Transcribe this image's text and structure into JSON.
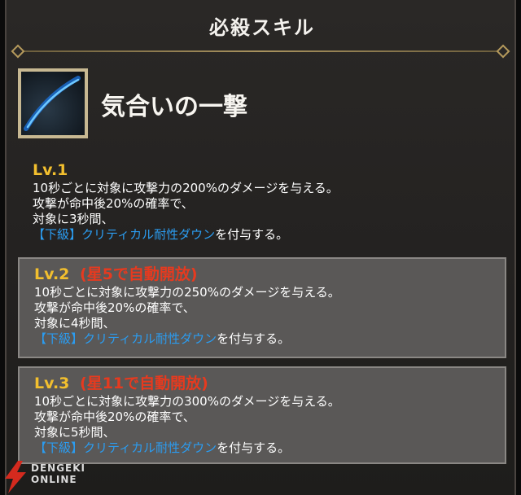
{
  "header": {
    "title": "必殺スキル"
  },
  "skill": {
    "icon": "slash-arc-icon",
    "name": "気合いの一撃"
  },
  "levels": [
    {
      "level": "Lv.1",
      "note": "",
      "lines": [
        "10秒ごとに対象に攻撃力の200%のダメージを与える。",
        "攻撃が命中後20%の確率で、",
        "対象に3秒間、"
      ],
      "debuff": "【下級】クリティカル耐性ダウン",
      "suffix": "を付与する。"
    },
    {
      "level": "Lv.2",
      "note": "(星5で自動開放)",
      "lines": [
        "10秒ごとに対象に攻撃力の250%のダメージを与える。",
        "攻撃が命中後20%の確率で、",
        "対象に4秒間、"
      ],
      "debuff": "【下級】クリティカル耐性ダウン",
      "suffix": "を付与する。"
    },
    {
      "level": "Lv.3",
      "note": "(星11で自動開放)",
      "lines": [
        "10秒ごとに対象に攻撃力の300%のダメージを与える。",
        "攻撃が命中後20%の確率で、",
        "対象に5秒間、"
      ],
      "debuff": "【下級】クリティカル耐性ダウン",
      "suffix": "を付与する。"
    }
  ],
  "watermark": {
    "line1": "DENGEKI",
    "line2": "ONLINE"
  },
  "colors": {
    "level_number": "#f2bf2e",
    "unlock_note": "#e63a1f",
    "debuff_text": "#2b9cf0",
    "box_bg": "#5a5857"
  }
}
